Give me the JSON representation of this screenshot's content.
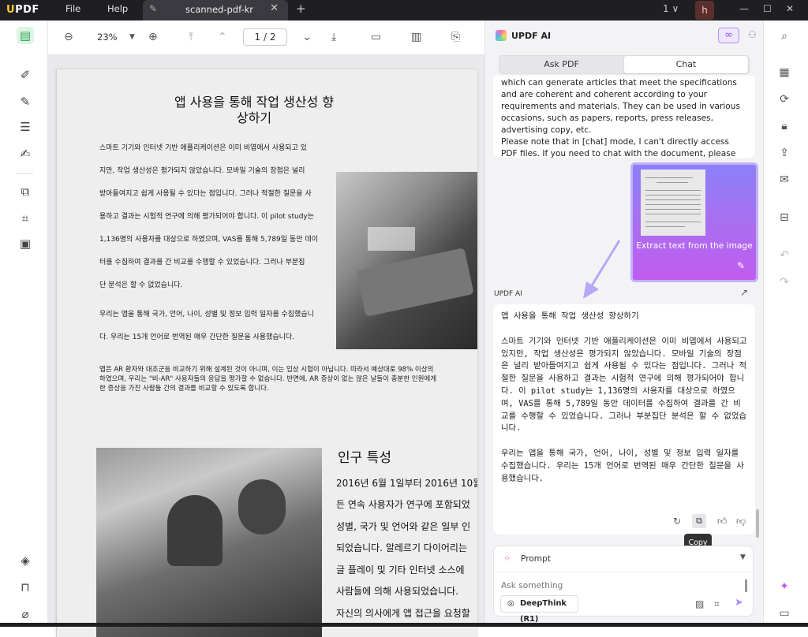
{
  "titlebar": {
    "logo": "UPDF",
    "menu_file": "File",
    "menu_help": "Help",
    "tab_label": "scanned-pdf-kr",
    "new_tab": "+",
    "page_count": "1",
    "avatar": "h"
  },
  "toolbar": {
    "zoom": "23%",
    "page": "1 / 2"
  },
  "document": {
    "title": "앱 사용을 통해 작업 생산성 향\n상하기",
    "lines": [
      "스마트 기기와 인터넷 기반 애플리케이션은 이미 비엽에서 사용되고 있",
      "지만, 작업 생산성은 평가되지 않았습니다. 모바일 기술의 장점은 널리",
      "받아들여지고 쉽게 사용될 수 있다는 점입니다. 그러나 적절한 질문을 사",
      "용하고 결과는 시험적 연구에 의해 평가되어야 합니다. 이 pilot study는",
      "1,136명의 사용자를 대상으로 하였으며, VAS를 통해 5,789일 동안 데이",
      "터를 수집하여 결과를 간 비교를 수행할 수 있었습니다. 그러나 부분집",
      "단 분석은 할 수 없었습니다.",
      "우리는 앱을 통해 국가, 언어, 나이, 성별 및 정보 입력 일자를 수집했습니",
      "다. 우리는 15개 언어로 번역된 매우 간단한 질문을 사용했습니다."
    ],
    "paragraph2": [
      "앱은 AR 환자와 대조군을 비교하기 위해 설계된 것이 아니며, 이는 임상 시험이 아닙니다. 따라서 예상대로 98% 이상의",
      "하였으며, 우리는 \"비-AR\" 사용자들의 응답을 평가할 수 없습니다. 반면에, AR 증상이 없는 많은 날들이 충분한 인원에게",
      "한 증상을 가진 사람들 간의 결과를 비교할 수 있도록 합니다."
    ],
    "section_title": "인구 특성",
    "section_lines": [
      "2016년 6월 1일부터 2016년 10월",
      "든 연속 사용자가 연구에 포함되었",
      "성별, 국가 및 언어와 같은 일부 인",
      "되었습니다. 알레르기 다이어리는",
      "글 플레이 및 기타 인터넷 소스에",
      "사람들에 의해 사용되었습니다.",
      "자신의 의사에게 앱 접근을 요청할"
    ]
  },
  "ai_panel": {
    "title": "UPDF AI",
    "tab_ask": "Ask PDF",
    "tab_chat": "Chat",
    "message1": "which can generate articles that meet the specifications and are coherent and coherent according to your requirements and materials. They can be used in various occasions, such as papers, reports, press releases, advertising copy, etc.\nPlease note that in [chat] mode, I can't directly access PDF files. If you need to chat with the document, please switch to [Ask PDF] mode.",
    "image_caption": "Extract text from the image",
    "ai_label": "UPDF AI",
    "response_title": "앱 사용을 통해 작업 생산성 향상하기",
    "response_p1": "스마트 기기와 인터넷 기반 애플리케이션은 이미 비엽에서 사용되고 있지만, 작업 생산성은 평가되지 않았습니다. 모바일 기술의 장점은 널리 받아들여지고 쉽게 사용될 수 있다는 점입니다. 그러나 적절한 질문을 사용하고 결과는 시험적 연구에 의해 평가되어야 합니다. 이 pilot study는 1,136명의 사용자를 대상으로 하였으며, VAS를 통해 5,789일 동안 데이터를 수집하여 결과를 간 비교를 수행할 수 있었습니다. 그러나 부분집단 분석은 할 수 없었습니다.",
    "response_p2": "우리는 앱을 통해 국가, 언어, 나이, 성별 및 정보 입력 일자를 수집했습니다. 우리는 15개 언어로 번역된 매우 간단한 질문을 사용했습니다.",
    "tooltip": "Copy",
    "prompt_label": "Prompt",
    "input_placeholder": "Ask something",
    "deepthink": "DeepThink (R1)"
  }
}
